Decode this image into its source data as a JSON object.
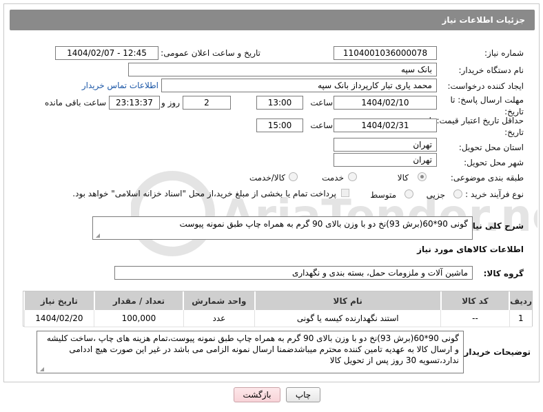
{
  "header": {
    "title": "جزئیات اطلاعات نیاز"
  },
  "need_number": {
    "label": "شماره نیاز:",
    "value": "1104001036000078"
  },
  "announce": {
    "label": "تاریخ و ساعت اعلان عمومی:",
    "value": "1404/02/07 - 12:45"
  },
  "buyer_org": {
    "label": "نام دستگاه خریدار:",
    "value": "بانک سپه"
  },
  "creator": {
    "label": "ایجاد کننده درخواست:",
    "value": "محمد یاری تبار کارپرداز بانک سپه",
    "contact_link": "اطلاعات تماس خریدار"
  },
  "response_deadline": {
    "label": "مهلت ارسال پاسخ: تا تاریخ:",
    "date": "1404/02/10",
    "time_label": "ساعت",
    "time": "13:00",
    "days": "2",
    "days_label": "روز و",
    "remaining": "23:13:37",
    "remaining_label": "ساعت باقی مانده"
  },
  "price_validity": {
    "label": "حداقل تاریخ اعتبار قیمت: تا تاریخ:",
    "date": "1404/02/31",
    "time_label": "ساعت",
    "time": "15:00"
  },
  "delivery_province": {
    "label": "استان محل تحویل:",
    "value": "تهران"
  },
  "delivery_city": {
    "label": "شهر محل تحویل:",
    "value": "تهران"
  },
  "category": {
    "label": "طبقه بندی موضوعی:",
    "options": [
      "کالا",
      "خدمت",
      "کالا/خدمت"
    ],
    "selected": "کالا"
  },
  "purchase_process": {
    "label": "نوع فرآیند خرید :",
    "options": [
      "جزیی",
      "متوسط"
    ],
    "selected": "",
    "note": "پرداخت تمام یا بخشی از مبلغ خرید،از محل \"اسناد خزانه اسلامی\" خواهد بود."
  },
  "general_desc": {
    "label": "شرح کلی نیاز:",
    "value": "گونی 90*60(برش 93)نخ دو با وزن بالای 90 گرم به همراه چاپ طبق نمونه پیوست"
  },
  "goods_info_title": "اطلاعات کالاهای مورد نیاز",
  "goods_group": {
    "label": "گروه کالا:",
    "value": "ماشین آلات و ملزومات حمل، بسته بندی و نگهداری"
  },
  "table": {
    "headers": [
      "ردیف",
      "کد کالا",
      "نام کالا",
      "واحد شمارش",
      "تعداد / مقدار",
      "تاریخ نیاز"
    ],
    "rows": [
      {
        "row": "1",
        "code": "--",
        "name": "استند نگهدارنده کیسه یا گونی",
        "unit": "عدد",
        "qty": "100,000",
        "date": "1404/02/20"
      }
    ]
  },
  "buyer_notes": {
    "label": "توضیحات خریدار:",
    "value": "گونی 90*60(برش 93)نخ دو با وزن بالای 90 گرم به همراه چاپ طبق نمونه پیوست،تمام هزینه های چاپ ،ساخت کلیشه و ارسال کالا به عهدیه تامین کننده محترم میباشدضمنا ارسال نمونه الزامی می باشد  در غیر این صورت هیچ اددامی ندارد،تسویه 30 روز پس از تحویل کالا"
  },
  "buttons": {
    "print": "چاپ",
    "back": "بازگشت"
  },
  "colors": {
    "header_bg": "#8a8a8a",
    "link": "#1a56a6",
    "back_button_bg": "#f8d3d8",
    "table_header_bg": "#cfcfcf"
  },
  "watermark_text": "AriaTender.neT"
}
